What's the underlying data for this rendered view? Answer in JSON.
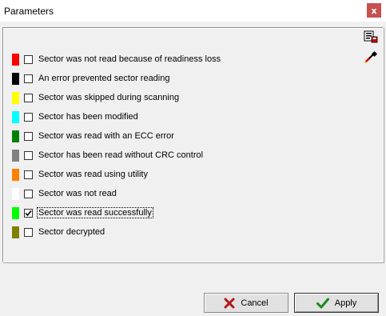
{
  "window": {
    "title": "Parameters",
    "close_label": "x"
  },
  "toolbar": {
    "icons": [
      "save-settings-icon",
      "pick-color-icon"
    ]
  },
  "items": [
    {
      "label": "Sector was not read because of readiness loss",
      "color": "#ff0000",
      "checked": false
    },
    {
      "label": "An error prevented sector reading",
      "color": "#000000",
      "checked": false
    },
    {
      "label": "Sector was skipped during scanning",
      "color": "#ffff00",
      "checked": false
    },
    {
      "label": "Sector has been modified",
      "color": "#00ffff",
      "checked": false
    },
    {
      "label": "Sector was read with an ECC error",
      "color": "#008000",
      "checked": false
    },
    {
      "label": "Sector has been read without CRC control",
      "color": "#808080",
      "checked": false
    },
    {
      "label": "Sector was read using utility",
      "color": "#ff8000",
      "checked": false
    },
    {
      "label": "Sector was not read",
      "color": "#ffffff",
      "checked": false
    },
    {
      "label": "Sector was read successfully",
      "color": "#00ff00",
      "checked": true
    },
    {
      "label": "Sector decrypted",
      "color": "#808000",
      "checked": false
    }
  ],
  "buttons": {
    "cancel_label": "Cancel",
    "apply_label": "Apply"
  }
}
